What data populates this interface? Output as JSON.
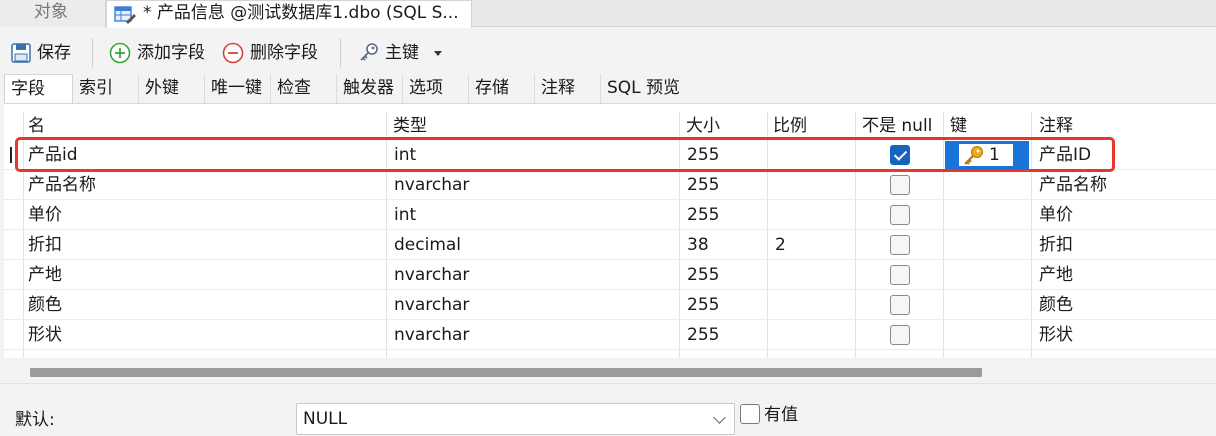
{
  "top_tabs": {
    "objects": "对象",
    "table": "* 产品信息 @测试数据库1.dbo (SQL S..."
  },
  "toolbar": {
    "save": "保存",
    "add_field": "添加字段",
    "delete_field": "删除字段",
    "primary_key": "主键"
  },
  "sub_tabs": [
    "字段",
    "索引",
    "外键",
    "唯一键",
    "检查",
    "触发器",
    "选项",
    "存储",
    "注释",
    "SQL 预览"
  ],
  "grid": {
    "headers": {
      "name": "名",
      "type": "类型",
      "size": "大小",
      "scale": "比例",
      "not_null": "不是 null",
      "key": "键",
      "comment": "注释"
    },
    "rows": [
      {
        "name": "产品id",
        "type": "int",
        "size": "255",
        "scale": "",
        "not_null": true,
        "key": "1",
        "comment": "产品ID"
      },
      {
        "name": "产品名称",
        "type": "nvarchar",
        "size": "255",
        "scale": "",
        "not_null": false,
        "key": "",
        "comment": "产品名称"
      },
      {
        "name": "单价",
        "type": "int",
        "size": "255",
        "scale": "",
        "not_null": false,
        "key": "",
        "comment": "单价"
      },
      {
        "name": "折扣",
        "type": "decimal",
        "size": "38",
        "scale": "2",
        "not_null": false,
        "key": "",
        "comment": "折扣"
      },
      {
        "name": "产地",
        "type": "nvarchar",
        "size": "255",
        "scale": "",
        "not_null": false,
        "key": "",
        "comment": "产地"
      },
      {
        "name": "颜色",
        "type": "nvarchar",
        "size": "255",
        "scale": "",
        "not_null": false,
        "key": "",
        "comment": "颜色"
      },
      {
        "name": "形状",
        "type": "nvarchar",
        "size": "255",
        "scale": "",
        "not_null": false,
        "key": "",
        "comment": "形状"
      }
    ]
  },
  "bottom": {
    "default_label": "默认:",
    "default_value": "NULL",
    "has_value_label": "有值"
  },
  "colors": {
    "highlight": "#e8352e",
    "key_cell": "#1a73d9",
    "checkbox_checked": "#1565c0"
  },
  "icons": [
    "table-icon",
    "save-icon",
    "add-icon",
    "delete-icon",
    "key-icon",
    "chevron-down-icon"
  ]
}
